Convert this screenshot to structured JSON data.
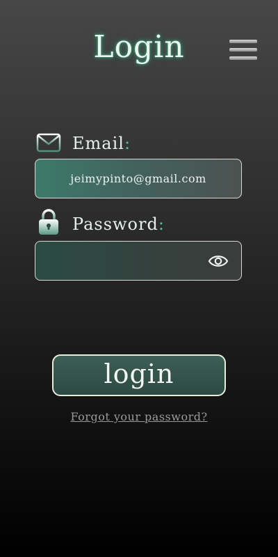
{
  "header": {
    "title": "Login",
    "menu_icon": "hamburger-menu-icon"
  },
  "form": {
    "email": {
      "label": "Email",
      "label_colon": ":",
      "icon": "mail-icon",
      "value": "jeimypinto@gmail.com"
    },
    "password": {
      "label": "Password",
      "label_colon": ":",
      "icon": "lock-icon",
      "value": "",
      "toggle_icon": "eye-icon"
    },
    "submit_label": "login",
    "forgot_label": "Forgot your password?"
  },
  "colors": {
    "accent": "#4ec49b",
    "title_glow": "#3f8c72",
    "button_border": "#e8eedc"
  }
}
